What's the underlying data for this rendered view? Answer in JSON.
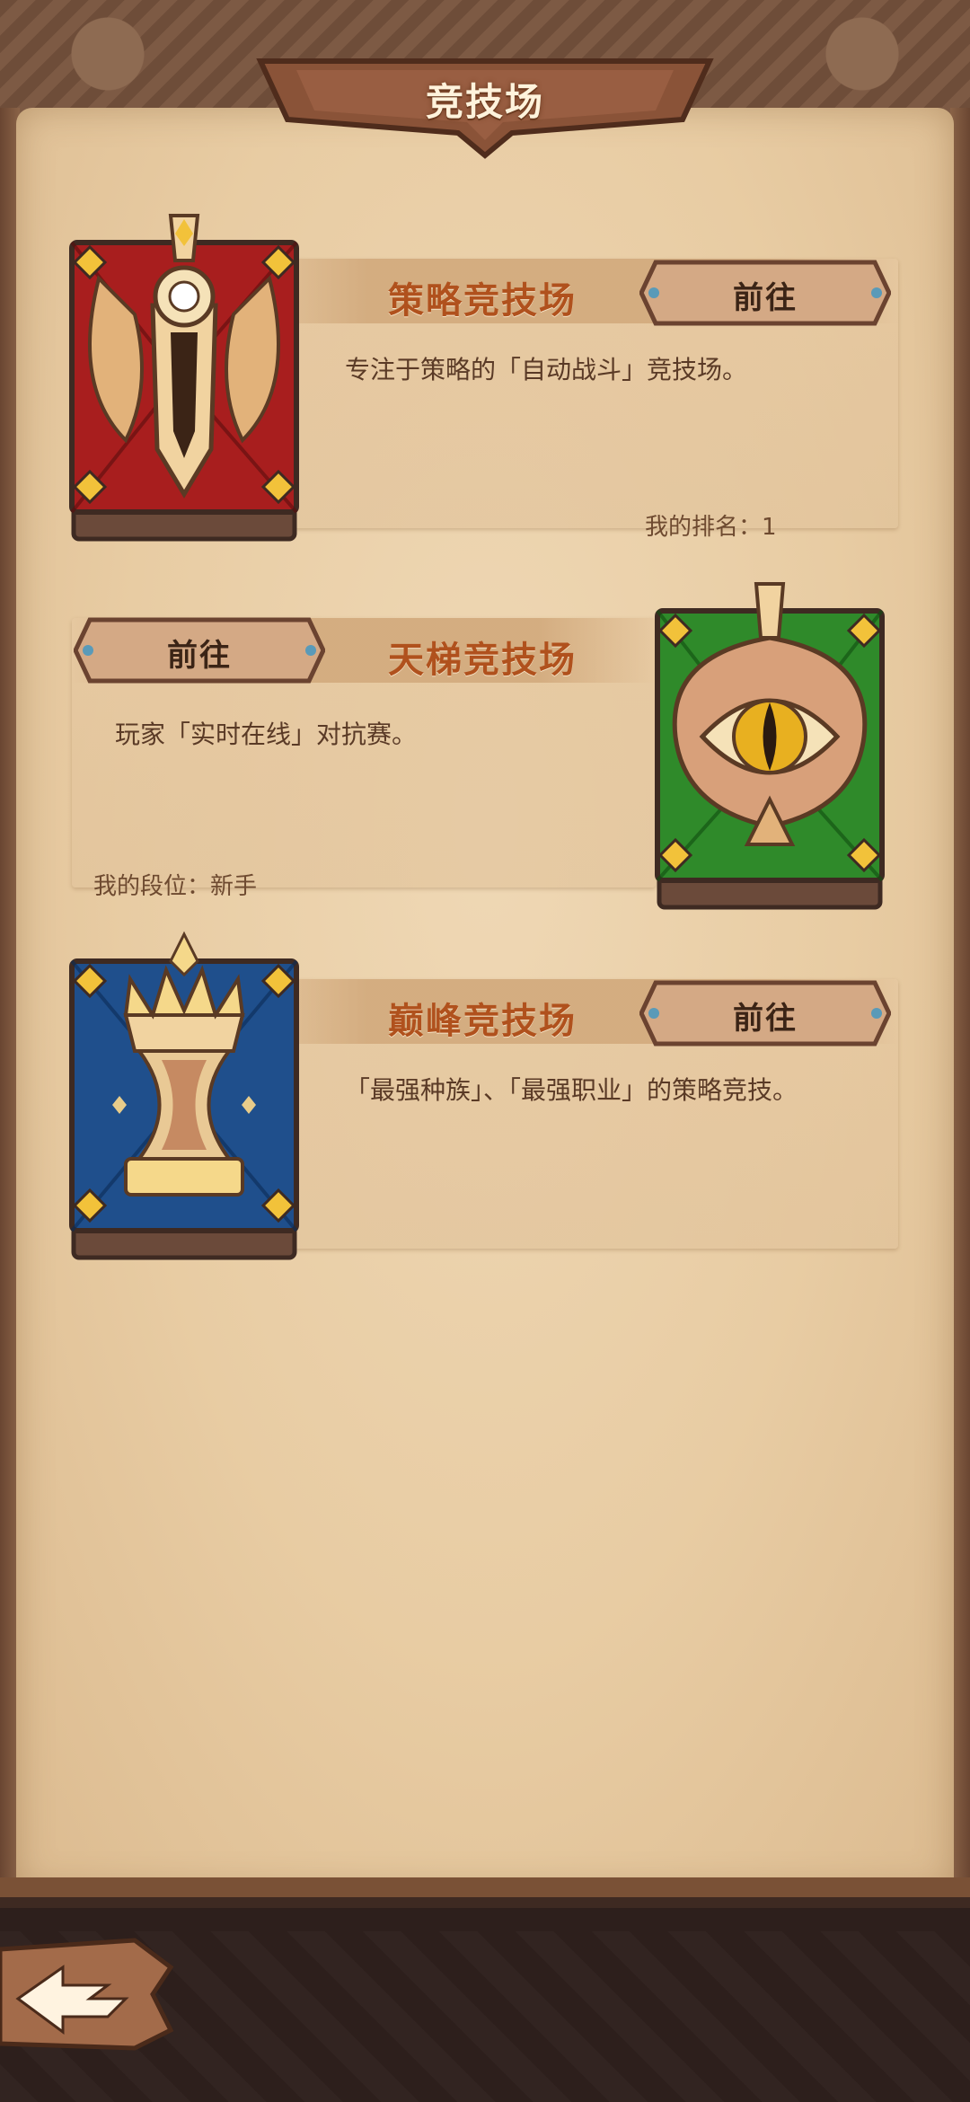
{
  "header": {
    "title": "竞技场"
  },
  "arenas": [
    {
      "name": "策略竞技场",
      "button": "前往",
      "description": "专注于策略的「自动战斗」竞技场。",
      "stat": "我的排名：1",
      "color": "#a81e1e"
    },
    {
      "name": "天梯竞技场",
      "button": "前往",
      "description": "玩家「实时在线」对抗赛。",
      "stat": "我的段位：新手",
      "color": "#2f8a2a"
    },
    {
      "name": "巅峰竞技场",
      "button": "前往",
      "description": "「最强种族」、「最强职业」的策略竞技。",
      "stat": "",
      "color": "#1f4f8c"
    }
  ],
  "icons": {
    "arena1": "sword-crest-icon",
    "arena2": "eye-crest-icon",
    "arena3": "chalice-crest-icon",
    "back": "back-arrow-icon"
  }
}
